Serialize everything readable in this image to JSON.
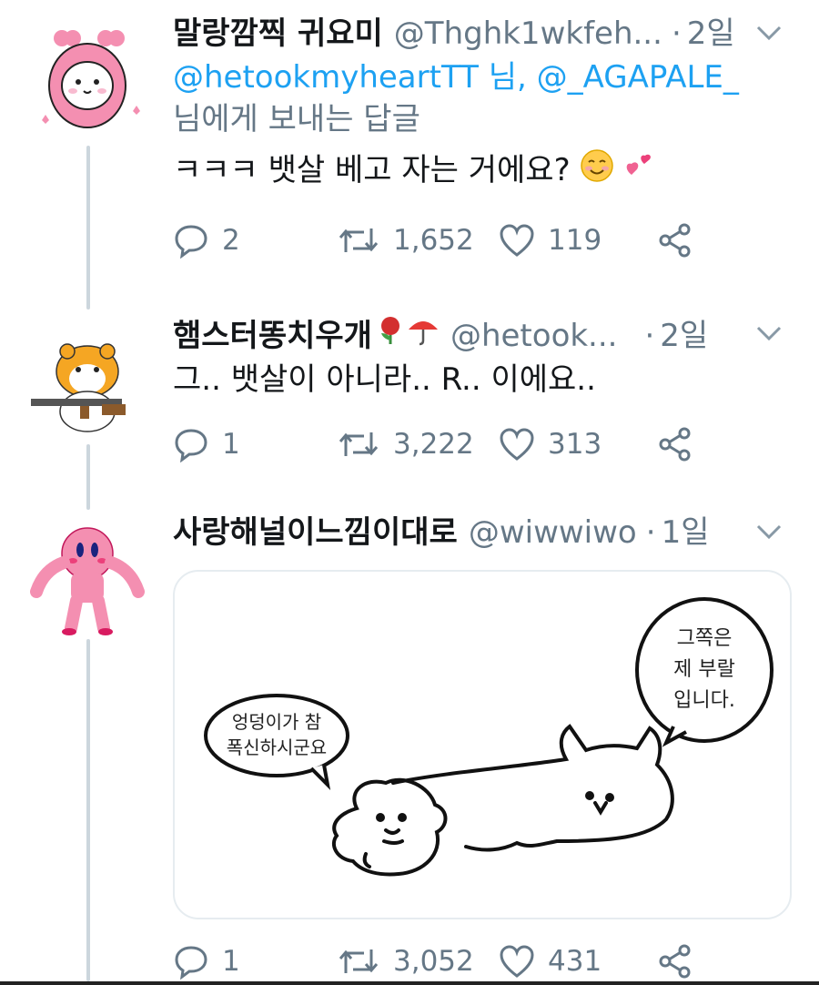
{
  "thread": {
    "tweets": [
      {
        "display_name": "말랑깜찍 귀요미",
        "handle": "@Thghk1wkfeh...",
        "time": "2일",
        "reply_mention_1": "@hetookmyheartTT 님,",
        "reply_mention_2": "@_AGAPALE_",
        "reply_suffix": "님에게 보내는 답글",
        "text": "ㅋㅋㅋ 뱃살 베고 자는 거에요?",
        "replies": "2",
        "retweets": "1,652",
        "likes": "119"
      },
      {
        "display_name": "햄스터똥치우개",
        "handle": "@hetook...",
        "time": "2일",
        "text": "그.. 뱃살이 아니라.. R.. 이에요..",
        "replies": "1",
        "retweets": "3,222",
        "likes": "313"
      },
      {
        "display_name": "사랑해널이느낌이대로",
        "handle": "@wiwwiwo",
        "time": "1일",
        "media": {
          "bubble_left_line1": "엉덩이가 참",
          "bubble_left_line2": "폭신하시군요",
          "bubble_right_line1": "그쪽은",
          "bubble_right_line2": "제 부랄",
          "bubble_right_line3": "입니다."
        },
        "replies": "1",
        "retweets": "3,052",
        "likes": "431"
      }
    ]
  },
  "icons": {
    "reply": "reply-icon",
    "retweet": "retweet-icon",
    "like": "heart-icon",
    "share": "share-icon",
    "more": "chevron-down-icon"
  },
  "colors": {
    "link": "#1da1f2",
    "muted": "#657786",
    "thread_line": "#ccd6dd"
  }
}
